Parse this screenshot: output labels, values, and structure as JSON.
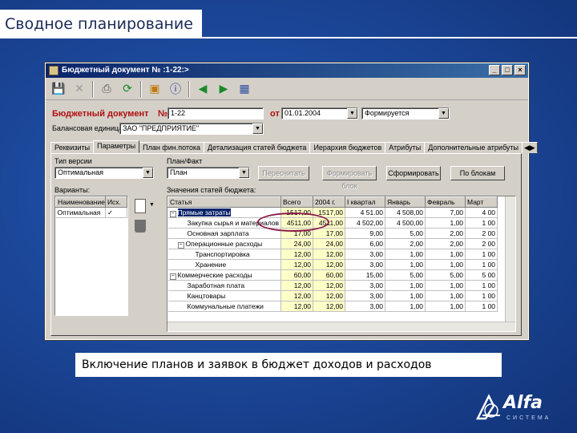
{
  "slide": {
    "title": "Сводное планирование",
    "caption": "Включение планов и заявок в бюджет доходов и расходов"
  },
  "window": {
    "title": "Бюджетный документ № :1-22:>",
    "buttons": [
      "_",
      "□",
      "×"
    ]
  },
  "toolbar": {
    "icons": [
      "save-icon",
      "delete-icon",
      "print-icon",
      "refresh-icon",
      "folder-icon",
      "info-icon",
      "back-arrow-icon",
      "forward-arrow-icon",
      "book-icon"
    ]
  },
  "header": {
    "doc_label": "Бюджетный документ",
    "number_label": "№",
    "number_value": "1-22",
    "from_label": "от",
    "date_value": "01.01.2004",
    "status_value": "Формируется",
    "unit_label": "Балансовая единица",
    "unit_value": "ЗАО \"ПРЕДПРИЯТИЕ\""
  },
  "tabs": [
    "Реквизиты",
    "Параметры",
    "План фин.потока",
    "Детализация статей бюджета",
    "Иерархия бюджетов",
    "Атрибуты",
    "Дополнительные атрибуты"
  ],
  "params": {
    "type_label": "Тип версии",
    "type_value": "Оптимальная",
    "plan_label": "План/Факт",
    "plan_value": "План",
    "btn_recalc": "Пересчитать",
    "btn_form_block": "Формировать блок",
    "btn_form": "Сформировать",
    "btn_blocks": "По блокам",
    "variants_label": "Варианты:",
    "values_label": "Значения статей бюджета:"
  },
  "variants_table": {
    "headers": [
      "Наименование",
      "Исх."
    ],
    "rows": [
      [
        "Оптимальная",
        "✓"
      ]
    ]
  },
  "main_table": {
    "headers": [
      "Статья",
      "Всего",
      "2004 г.",
      "I квартал",
      "Январь",
      "Февраль",
      "Март"
    ],
    "rows": [
      {
        "expand": "−",
        "indent": 0,
        "name": "Прямые затраты",
        "values": [
          "1517,00",
          "1517,00",
          "4 51.00",
          "4 508,00",
          "7,00",
          "4 00"
        ],
        "selected": true
      },
      {
        "expand": "",
        "indent": 1,
        "name": "Закупка сырья и материалов",
        "values": [
          "4511,00",
          "4511,00",
          "4 502,00",
          "4 500,00",
          "1,00",
          "1 00"
        ]
      },
      {
        "expand": "",
        "indent": 1,
        "name": "Основная зарплата",
        "values": [
          "17,00",
          "17,00",
          "9,00",
          "5,00",
          "2,00",
          "2 00"
        ]
      },
      {
        "expand": "−",
        "indent": 1,
        "name": "Операционные расходы",
        "values": [
          "24,00",
          "24,00",
          "6,00",
          "2,00",
          "2,00",
          "2 00"
        ]
      },
      {
        "expand": "",
        "indent": 2,
        "name": "Транспортировка",
        "values": [
          "12,00",
          "12,00",
          "3,00",
          "1,00",
          "1,00",
          "1 00"
        ]
      },
      {
        "expand": "",
        "indent": 2,
        "name": "Хранение",
        "values": [
          "12,00",
          "12,00",
          "3,00",
          "1,00",
          "1,00",
          "1 00"
        ]
      },
      {
        "expand": "−",
        "indent": 0,
        "name": "Коммерческие расходы",
        "values": [
          "60,00",
          "60,00",
          "15,00",
          "5,00",
          "5,00",
          "5 00"
        ]
      },
      {
        "expand": "",
        "indent": 1,
        "name": "Заработная плата",
        "values": [
          "12,00",
          "12,00",
          "3,00",
          "1,00",
          "1,00",
          "1 00"
        ]
      },
      {
        "expand": "",
        "indent": 1,
        "name": "Канцтовары",
        "values": [
          "12,00",
          "12,00",
          "3,00",
          "1,00",
          "1,00",
          "1 00"
        ]
      },
      {
        "expand": "",
        "indent": 1,
        "name": "Коммунальные платежи",
        "values": [
          "12,00",
          "12,00",
          "3,00",
          "1,00",
          "1,00",
          "1 00"
        ]
      }
    ]
  },
  "logo": {
    "text": "Alfa",
    "sub": "СИСТЕМА"
  }
}
